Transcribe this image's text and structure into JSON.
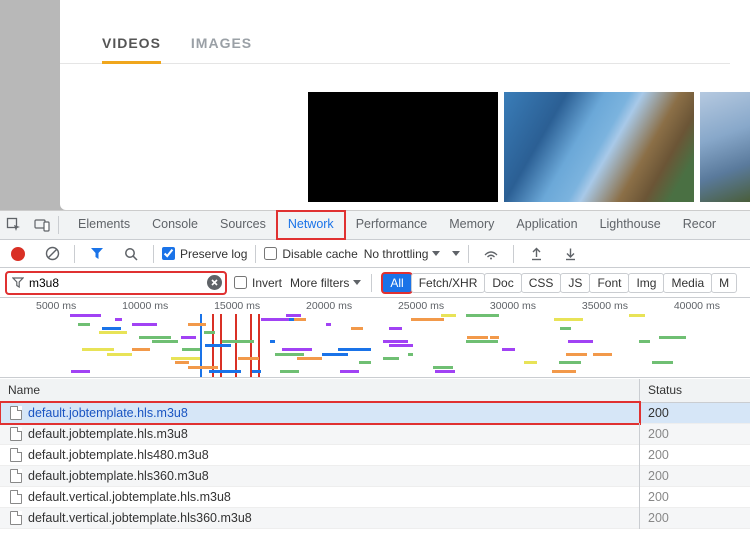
{
  "page": {
    "tabs": [
      "VIDEOS",
      "IMAGES"
    ],
    "active_tab": 0
  },
  "devtools": {
    "main_tabs": [
      "Elements",
      "Console",
      "Sources",
      "Network",
      "Performance",
      "Memory",
      "Application",
      "Lighthouse",
      "Recor"
    ],
    "active_main_tab": 3,
    "preserve_log_label": "Preserve log",
    "preserve_log_checked": true,
    "disable_cache_label": "Disable cache",
    "disable_cache_checked": false,
    "throttling_label": "No throttling",
    "filter_value": "m3u8",
    "invert_label": "Invert",
    "invert_checked": false,
    "more_filters_label": "More filters",
    "type_filters": [
      "All",
      "Fetch/XHR",
      "Doc",
      "CSS",
      "JS",
      "Font",
      "Img",
      "Media",
      "M"
    ],
    "active_type_filter": 0,
    "timeline_ticks": [
      "5000 ms",
      "10000 ms",
      "15000 ms",
      "20000 ms",
      "25000 ms",
      "30000 ms",
      "35000 ms",
      "40000 ms"
    ],
    "columns": {
      "name": "Name",
      "status": "Status"
    },
    "requests": [
      {
        "name": "default.jobtemplate.hls.m3u8",
        "status": "200",
        "selected": true
      },
      {
        "name": "default.jobtemplate.hls.m3u8",
        "status": "200",
        "selected": false
      },
      {
        "name": "default.jobtemplate.hls480.m3u8",
        "status": "200",
        "selected": false
      },
      {
        "name": "default.jobtemplate.hls360.m3u8",
        "status": "200",
        "selected": false
      },
      {
        "name": "default.vertical.jobtemplate.hls.m3u8",
        "status": "200",
        "selected": false
      },
      {
        "name": "default.vertical.jobtemplate.hls360.m3u8",
        "status": "200",
        "selected": false
      }
    ]
  }
}
